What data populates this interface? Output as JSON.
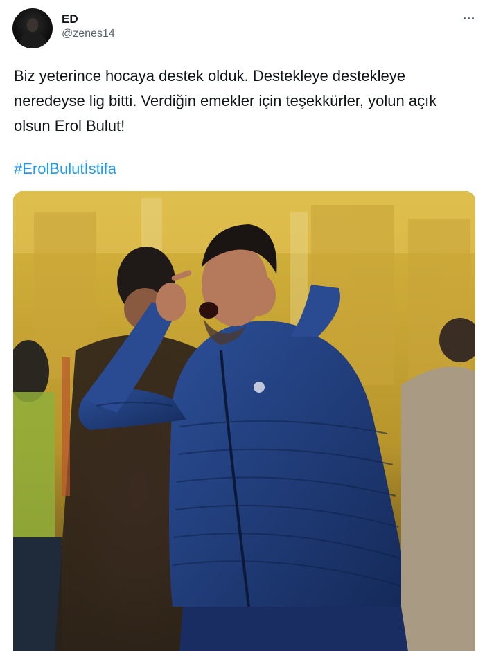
{
  "tweet": {
    "author_name": "ED",
    "author_handle": "@zenes14",
    "text": "Biz yeterince hocaya destek olduk. Destekleye destekleye neredeyse lig bitti. Verdiğin emekler için teşekkürler, yolun açık olsun Erol Bulut!",
    "hashtag": "#ErolBulutİstifa",
    "more_icon": "more-horizontal-icon"
  },
  "colors": {
    "link": "#1d9bf0",
    "secondary_text": "#536471",
    "stadium_yellow": "#d9b53a",
    "jacket_navy": "#1d3a78"
  }
}
